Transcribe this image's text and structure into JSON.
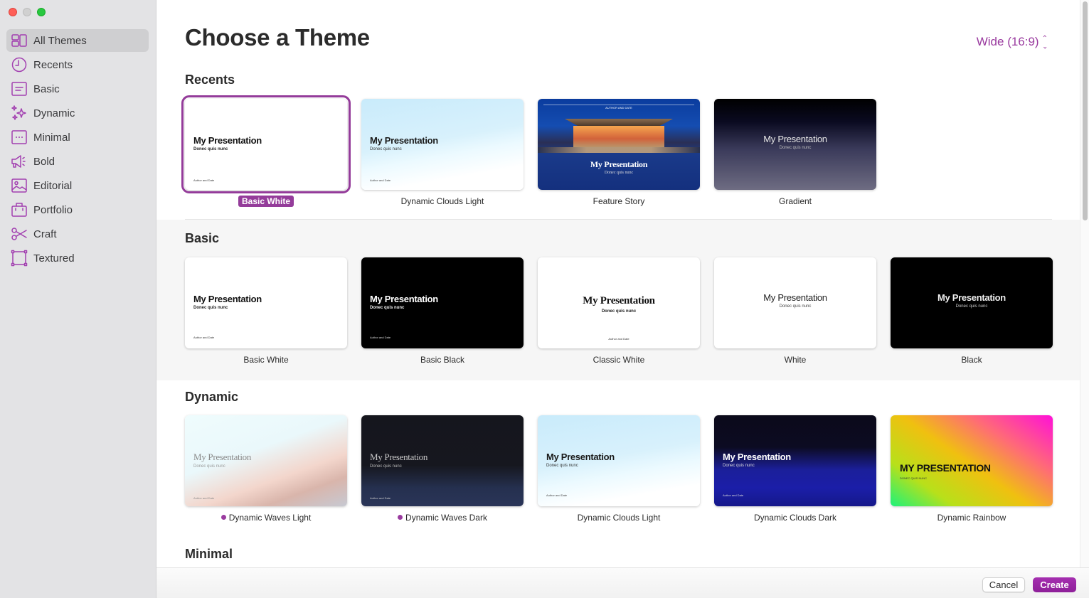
{
  "window": {
    "controls": [
      "close",
      "minimize",
      "maximize"
    ]
  },
  "sidebar": {
    "items": [
      {
        "label": "All Themes",
        "icon": "all-themes-icon",
        "active": true
      },
      {
        "label": "Recents",
        "icon": "clock-icon"
      },
      {
        "label": "Basic",
        "icon": "basic-icon"
      },
      {
        "label": "Dynamic",
        "icon": "sparkles-icon"
      },
      {
        "label": "Minimal",
        "icon": "minimal-icon"
      },
      {
        "label": "Bold",
        "icon": "megaphone-icon"
      },
      {
        "label": "Editorial",
        "icon": "photo-icon"
      },
      {
        "label": "Portfolio",
        "icon": "briefcase-icon"
      },
      {
        "label": "Craft",
        "icon": "scissors-icon"
      },
      {
        "label": "Textured",
        "icon": "frame-icon"
      }
    ]
  },
  "header": {
    "title": "Choose a Theme",
    "size_select": "Wide (16:9)"
  },
  "sections": {
    "recents": {
      "title": "Recents",
      "themes": [
        {
          "name": "Basic White",
          "selected": true,
          "slide_title": "My Presentation",
          "slide_sub": "Donec quis nunc",
          "slide_author": "Author and Date"
        },
        {
          "name": "Dynamic Clouds Light",
          "slide_title": "My Presentation",
          "slide_sub": "Donec quis nunc",
          "slide_author": "Author and Date"
        },
        {
          "name": "Feature Story",
          "slide_title": "My Presentation",
          "slide_sub": "Donec quis nunc",
          "slide_author": "AUTHOR AND DATE"
        },
        {
          "name": "Gradient",
          "slide_title": "My Presentation",
          "slide_sub": "Donec quis nunc"
        }
      ]
    },
    "basic": {
      "title": "Basic",
      "themes": [
        {
          "name": "Basic White",
          "slide_title": "My Presentation",
          "slide_sub": "Donec quis nunc",
          "slide_author": "Author and Date"
        },
        {
          "name": "Basic Black",
          "slide_title": "My Presentation",
          "slide_sub": "Donec quis nunc",
          "slide_author": "Author and Date"
        },
        {
          "name": "Classic White",
          "slide_title": "My Presentation",
          "slide_sub": "Donec quis nunc",
          "slide_author": "Author and Date"
        },
        {
          "name": "White",
          "slide_title": "My Presentation",
          "slide_sub": "Donec quis nunc"
        },
        {
          "name": "Black",
          "slide_title": "My Presentation",
          "slide_sub": "Donec quis nunc"
        }
      ]
    },
    "dynamic": {
      "title": "Dynamic",
      "themes": [
        {
          "name": "Dynamic Waves Light",
          "dot": true,
          "slide_title": "My Presentation",
          "slide_sub": "Donec quis nunc",
          "slide_author": "Author and Date"
        },
        {
          "name": "Dynamic Waves Dark",
          "dot": true,
          "slide_title": "My Presentation",
          "slide_sub": "Donec quis nunc",
          "slide_author": "Author and Date"
        },
        {
          "name": "Dynamic Clouds Light",
          "slide_title": "My Presentation",
          "slide_sub": "Donec quis nunc",
          "slide_author": "Author and Date"
        },
        {
          "name": "Dynamic Clouds Dark",
          "slide_title": "My Presentation",
          "slide_sub": "Donec quis nunc",
          "slide_author": "Author and Date"
        },
        {
          "name": "Dynamic Rainbow",
          "slide_title": "MY PRESENTATION",
          "slide_sub": "DONEC QUIS NUNC"
        }
      ]
    },
    "minimal": {
      "title": "Minimal"
    }
  },
  "colors": {
    "accent": "#943c9a",
    "sidebar_bg": "#e3e3e5"
  },
  "footer": {
    "cancel_label": "Cancel",
    "create_label": "Create"
  }
}
